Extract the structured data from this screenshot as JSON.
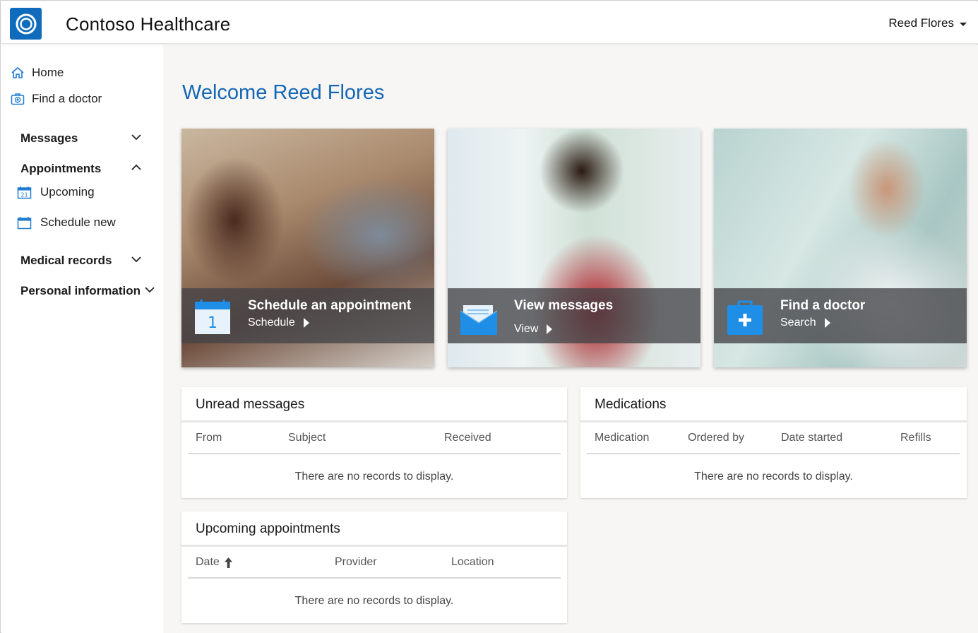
{
  "header": {
    "app_title": "Contoso Healthcare",
    "user_name": "Reed Flores",
    "brand_color": "#0f6cbd"
  },
  "sidebar": {
    "links": [
      {
        "label": "Home",
        "icon": "home-icon"
      },
      {
        "label": "Find a doctor",
        "icon": "doctor-bag-icon"
      }
    ],
    "sections": [
      {
        "label": "Messages",
        "expanded": false,
        "items": []
      },
      {
        "label": "Appointments",
        "expanded": true,
        "items": [
          {
            "label": "Upcoming",
            "icon": "calendar-icon"
          },
          {
            "label": "Schedule new",
            "icon": "calendar-icon"
          }
        ]
      },
      {
        "label": "Medical records",
        "expanded": false,
        "items": []
      },
      {
        "label": "Personal information",
        "expanded": false,
        "items": []
      }
    ]
  },
  "main": {
    "welcome": "Welcome Reed Flores",
    "welcome_color": "#1567b3",
    "tiles": [
      {
        "title": "Schedule an appointment",
        "action": "Schedule",
        "icon": "calendar-icon"
      },
      {
        "title": "View messages",
        "action": "View",
        "icon": "envelope-icon"
      },
      {
        "title": "Find a doctor",
        "action": "Search",
        "icon": "medical-kit-icon"
      }
    ],
    "unread_messages": {
      "title": "Unread messages",
      "columns": [
        "From",
        "Subject",
        "Received"
      ],
      "empty_text": "There are no records to display."
    },
    "medications": {
      "title": "Medications",
      "columns": [
        "Medication",
        "Ordered by",
        "Date started",
        "Refills"
      ],
      "empty_text": "There are no records to display."
    },
    "upcoming_appointments": {
      "title": "Upcoming appointments",
      "columns": [
        "Date",
        "Provider",
        "Location"
      ],
      "sort_icon": "arrow-up-icon",
      "empty_text": "There are no records to display."
    }
  }
}
